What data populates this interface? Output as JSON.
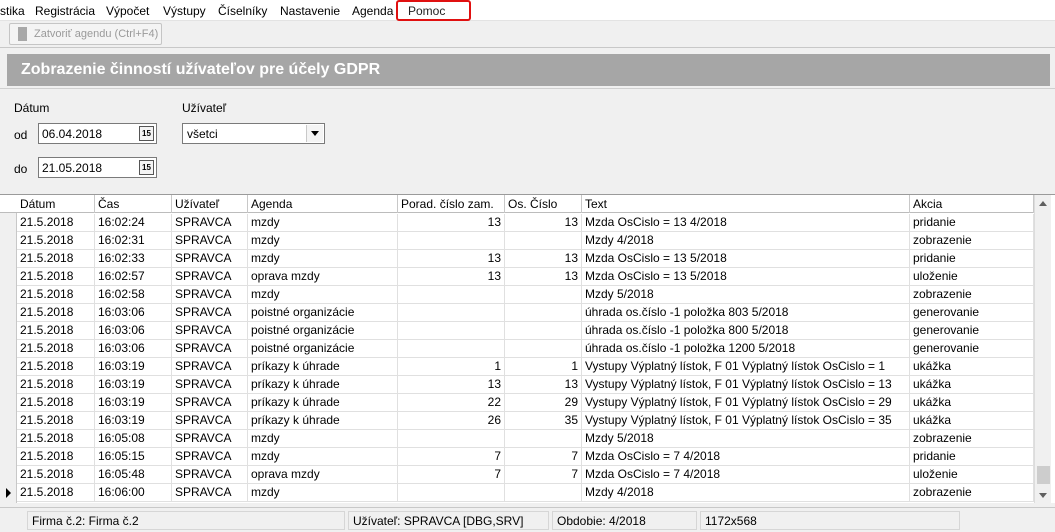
{
  "menu": [
    {
      "label": "stika"
    },
    {
      "label": "Registrácia"
    },
    {
      "label": "Výpočet"
    },
    {
      "label": "Výstupy"
    },
    {
      "label": "Číselníky"
    },
    {
      "label": "Nastavenie"
    },
    {
      "label": "Agenda"
    },
    {
      "label": "Pomoc"
    }
  ],
  "toolbar": {
    "close_label": "Zatvoriť agendu (Ctrl+F4)"
  },
  "page": {
    "title": "Zobrazenie činností užívateľov pre účely GDPR"
  },
  "filters": {
    "date_label": "Dátum",
    "from_label": "od",
    "from_value": "06.04.2018",
    "to_label": "do",
    "to_value": "21.05.2018",
    "calendar_glyph": "15",
    "user_label": "Užívateľ",
    "user_value": "všetci"
  },
  "grid": {
    "columns": [
      "Dátum",
      "Čas",
      "Užívateľ",
      "Agenda",
      "Porad.  číslo zam.",
      "Os. Číslo",
      "Text",
      "Akcia"
    ],
    "rows": [
      [
        "21.5.2018",
        "16:02:24",
        "SPRAVCA",
        "mzdy",
        "13",
        "13",
        "Mzda OsCislo = 13 4/2018",
        "pridanie"
      ],
      [
        "21.5.2018",
        "16:02:31",
        "SPRAVCA",
        "mzdy",
        "",
        "",
        "Mzdy 4/2018",
        "zobrazenie"
      ],
      [
        "21.5.2018",
        "16:02:33",
        "SPRAVCA",
        "mzdy",
        "13",
        "13",
        "Mzda OsCislo = 13 5/2018",
        "pridanie"
      ],
      [
        "21.5.2018",
        "16:02:57",
        "SPRAVCA",
        "oprava mzdy",
        "13",
        "13",
        "Mzda OsCislo = 13 5/2018",
        "uloženie"
      ],
      [
        "21.5.2018",
        "16:02:58",
        "SPRAVCA",
        "mzdy",
        "",
        "",
        "Mzdy 5/2018",
        "zobrazenie"
      ],
      [
        "21.5.2018",
        "16:03:06",
        "SPRAVCA",
        "poistné organizácie",
        "",
        "",
        "úhrada os.číslo -1 položka 803 5/2018",
        "generovanie"
      ],
      [
        "21.5.2018",
        "16:03:06",
        "SPRAVCA",
        "poistné organizácie",
        "",
        "",
        "úhrada os.číslo -1 položka 800 5/2018",
        "generovanie"
      ],
      [
        "21.5.2018",
        "16:03:06",
        "SPRAVCA",
        "poistné organizácie",
        "",
        "",
        "úhrada os.číslo -1 položka 1200 5/2018",
        "generovanie"
      ],
      [
        "21.5.2018",
        "16:03:19",
        "SPRAVCA",
        "príkazy k úhrade",
        "1",
        "1",
        "Vystupy Výplatný lístok, F 01 Výplatný lístok OsCislo = 1",
        "ukážka"
      ],
      [
        "21.5.2018",
        "16:03:19",
        "SPRAVCA",
        "príkazy k úhrade",
        "13",
        "13",
        "Vystupy Výplatný lístok, F 01 Výplatný lístok OsCislo = 13",
        "ukážka"
      ],
      [
        "21.5.2018",
        "16:03:19",
        "SPRAVCA",
        "príkazy k úhrade",
        "22",
        "29",
        "Vystupy Výplatný lístok, F 01 Výplatný lístok OsCislo = 29",
        "ukážka"
      ],
      [
        "21.5.2018",
        "16:03:19",
        "SPRAVCA",
        "príkazy k úhrade",
        "26",
        "35",
        "Vystupy Výplatný lístok, F 01 Výplatný lístok OsCislo = 35",
        "ukážka"
      ],
      [
        "21.5.2018",
        "16:05:08",
        "SPRAVCA",
        "mzdy",
        "",
        "",
        "Mzdy 5/2018",
        "zobrazenie"
      ],
      [
        "21.5.2018",
        "16:05:15",
        "SPRAVCA",
        "mzdy",
        "7",
        "7",
        "Mzda OsCislo = 7 4/2018",
        "pridanie"
      ],
      [
        "21.5.2018",
        "16:05:48",
        "SPRAVCA",
        "oprava mzdy",
        "7",
        "7",
        "Mzda OsCislo = 7 4/2018",
        "uloženie"
      ],
      [
        "21.5.2018",
        "16:06:00",
        "SPRAVCA",
        "mzdy",
        "",
        "",
        "Mzdy 4/2018",
        "zobrazenie"
      ]
    ]
  },
  "status": {
    "company": "Firma č.2: Firma č.2",
    "user": "Užívateľ: SPRAVCA [DBG,SRV]",
    "period": "Obdobie: 4/2018",
    "resolution": "1172x568"
  },
  "colors": {
    "title_bar": "#a6a6a6",
    "highlight_box": "#e01010"
  }
}
